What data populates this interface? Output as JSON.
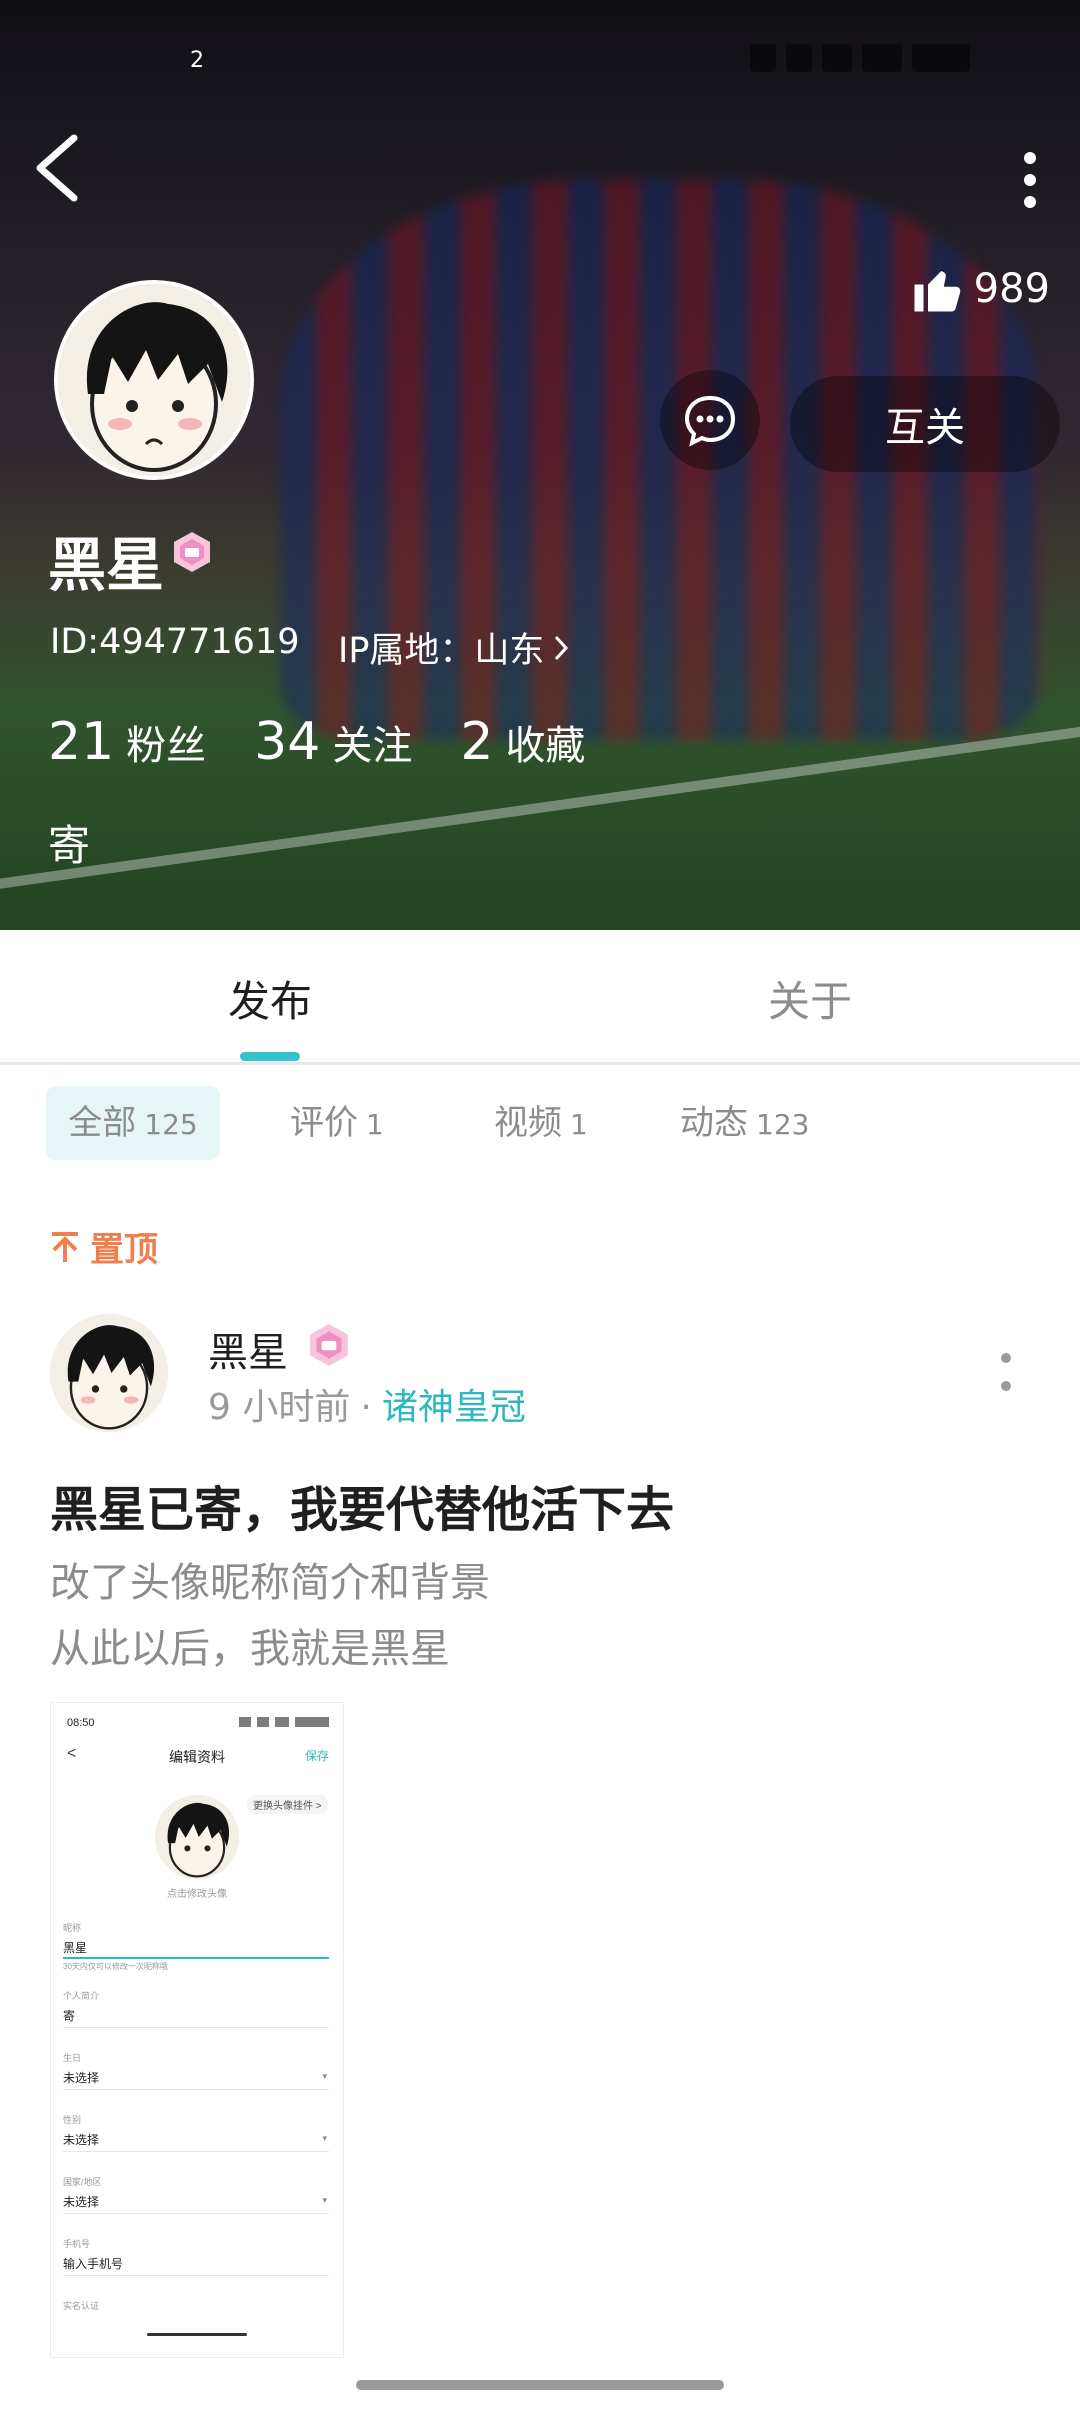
{
  "status_bar": {
    "notification_count": "2"
  },
  "header": {
    "likes": "989",
    "follow_label": "互关",
    "username": "黑星",
    "id_text": "ID:494771619",
    "ip_text": "IP属地：山东",
    "stats": [
      {
        "num": "21",
        "label": "粉丝"
      },
      {
        "num": "34",
        "label": "关注"
      },
      {
        "num": "2",
        "label": "收藏"
      }
    ],
    "bio": "寄"
  },
  "tabs": {
    "publish": "发布",
    "about": "关于"
  },
  "filters": [
    {
      "label": "全部",
      "count": "125"
    },
    {
      "label": "评价",
      "count": "1"
    },
    {
      "label": "视频",
      "count": "1"
    },
    {
      "label": "动态",
      "count": "123"
    }
  ],
  "pinned_label": "置顶",
  "post": {
    "author": "黑星",
    "time": "9 小时前",
    "separator": "·",
    "tag": "诸神皇冠",
    "title": "黑星已寄，我要代替他活下去",
    "line1": "改了头像昵称简介和背景",
    "line2": "从此以后，我就是黑星"
  },
  "screenshot": {
    "time": "08:50",
    "title": "编辑资料",
    "save": "保存",
    "back": "<",
    "change_frame": "更换头像挂件 >",
    "tap_edit": "点击修改头像",
    "nickname_label": "昵称",
    "nickname_value": "黑星",
    "nickname_hint": "30天内仅可以修改一次昵称哦",
    "intro_label": "个人简介",
    "intro_value": "寄",
    "birthday_label": "生日",
    "birthday_value": "未选择",
    "gender_label": "性别",
    "gender_value": "未选择",
    "region_label": "国家/地区",
    "region_value": "未选择",
    "phone_label": "手机号",
    "phone_value": "输入手机号",
    "realname_label": "实名认证"
  }
}
